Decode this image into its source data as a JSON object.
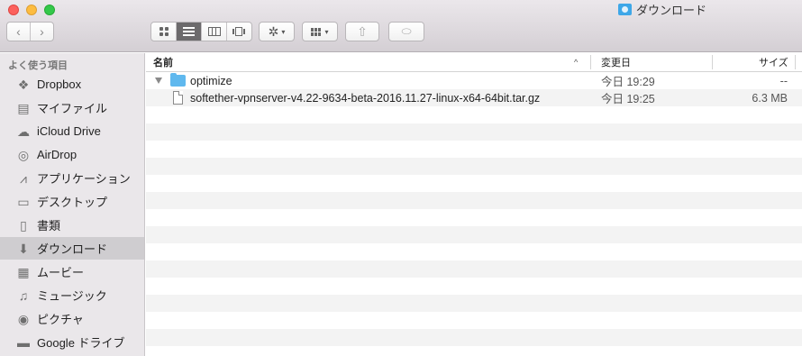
{
  "window": {
    "title": "ダウンロード"
  },
  "toolbar": {
    "back_glyph": "‹",
    "forward_glyph": "›",
    "action_glyph": "✲",
    "chevron_glyph": "▾",
    "share_glyph": "⇧",
    "tag_glyph": "⬭"
  },
  "sidebar": {
    "heading": "よく使う項目",
    "items": [
      {
        "label": "Dropbox",
        "icon": "dropbox-icon",
        "glyph": "❖"
      },
      {
        "label": "マイファイル",
        "icon": "all-my-files-icon",
        "glyph": "▤"
      },
      {
        "label": "iCloud Drive",
        "icon": "cloud-icon",
        "glyph": "☁"
      },
      {
        "label": "AirDrop",
        "icon": "airdrop-icon",
        "glyph": "◎"
      },
      {
        "label": "アプリケーション",
        "icon": "applications-icon",
        "glyph": "⩘"
      },
      {
        "label": "デスクトップ",
        "icon": "desktop-icon",
        "glyph": "▭"
      },
      {
        "label": "書類",
        "icon": "documents-icon",
        "glyph": "▯"
      },
      {
        "label": "ダウンロード",
        "icon": "downloads-icon",
        "glyph": "⬇"
      },
      {
        "label": "ムービー",
        "icon": "movies-icon",
        "glyph": "▦"
      },
      {
        "label": "ミュージック",
        "icon": "music-icon",
        "glyph": "♫"
      },
      {
        "label": "ピクチャ",
        "icon": "pictures-icon",
        "glyph": "◉"
      },
      {
        "label": "Google ドライブ",
        "icon": "folder-icon",
        "glyph": "▬"
      }
    ],
    "selected": "ダウンロード"
  },
  "list": {
    "columns": {
      "name": "名前",
      "sort_indicator": "^",
      "date": "変更日",
      "size": "サイズ"
    },
    "rows": [
      {
        "name": "optimize",
        "date": "今日 19:29",
        "size": "--",
        "kind": "folder",
        "expanded": true
      },
      {
        "name": "softether-vpnserver-v4.22-9634-beta-2016.11.27-linux-x64-64bit.tar.gz",
        "date": "今日 19:25",
        "size": "6.3 MB",
        "kind": "file"
      }
    ]
  },
  "colors": {
    "sidebar_bg": "#eae7ea",
    "selected_bg": "#cfcdd0",
    "folder_blue": "#5fb8ee",
    "zebra": "#f3f3f3"
  }
}
